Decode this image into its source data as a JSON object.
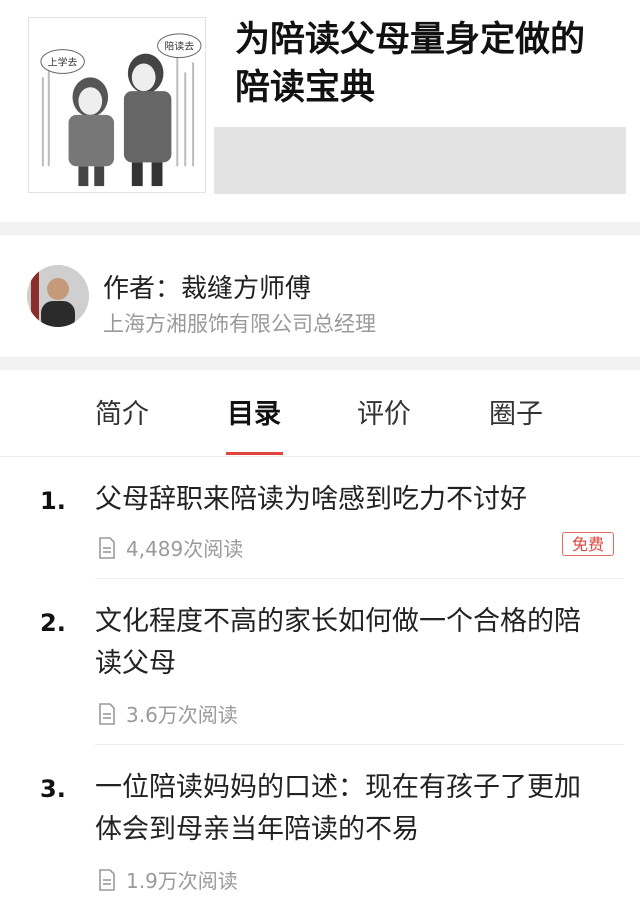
{
  "book": {
    "title": "为陪读父母量身定做的陪读宝典",
    "cover_signs": [
      "上学去",
      "陪读去"
    ]
  },
  "author": {
    "name": "作者：裁缝方师傅",
    "title": "上海方湘服饰有限公司总经理"
  },
  "tabs": [
    {
      "label": "简介",
      "active": false
    },
    {
      "label": "目录",
      "active": true
    },
    {
      "label": "评价",
      "active": false
    },
    {
      "label": "圈子",
      "active": false
    }
  ],
  "accent_color": "#e0453d",
  "chapters": [
    {
      "num": "1.",
      "title": "父母辞职来陪读为啥感到吃力不讨好",
      "reads": "4,489次阅读",
      "badge": "免费"
    },
    {
      "num": "2.",
      "title": "文化程度不高的家长如何做一个合格的陪读父母",
      "reads": "3.6万次阅读"
    },
    {
      "num": "3.",
      "title": "一位陪读妈妈的口述：现在有孩子了更加体会到母亲当年陪读的不易",
      "reads": "1.9万次阅读"
    }
  ]
}
